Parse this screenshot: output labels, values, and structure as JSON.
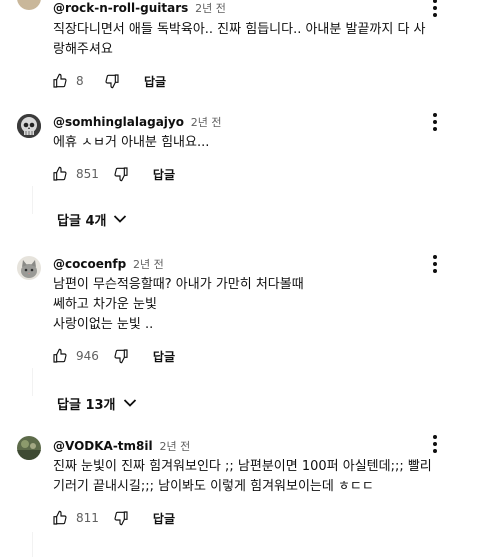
{
  "comments": [
    {
      "handle": "@rock-n-roll-guitars",
      "time": "2년 전",
      "lines": [
        "직장다니면서 애들 독박육아.. 진짜 힘듭니다.. 아내분 발끝까지 다 사",
        "랑해주셔요"
      ],
      "likes": "8",
      "reply_label": "답글",
      "avatar_icon": "cropped-avatar"
    },
    {
      "handle": "@somhinglalagajyo",
      "time": "2년 전",
      "lines": [
        "에휴 ㅅㅂ거 아내분 힘내요..."
      ],
      "likes": "851",
      "reply_label": "답글",
      "replies_label": "답글 4개",
      "avatar_icon": "skull-avatar"
    },
    {
      "handle": "@cocoenfp",
      "time": "2년 전",
      "lines": [
        "남편이 무슨적응할때? 아내가 가만히 처다볼때",
        "쎄하고 차가운 눈빛",
        "사랑이없는 눈빛 .."
      ],
      "likes": "946",
      "reply_label": "답글",
      "replies_label": "답글 13개",
      "avatar_icon": "cat-avatar"
    },
    {
      "handle": "@VODKA-tm8il",
      "time": "2년 전",
      "lines": [
        "진짜 눈빛이 진짜 힘겨워보인다 ;; 남편분이면 100퍼 아실텐데;;; 빨리",
        "기러기 끝내시길;;; 남이봐도 이렇게 힘겨워보이는데 ㅎㄷㄷ"
      ],
      "likes": "811",
      "reply_label": "답글",
      "avatar_icon": "photo-avatar"
    }
  ],
  "colors": {
    "text": "#0f0f0f",
    "secondary": "#606060",
    "background": "#ffffff"
  }
}
